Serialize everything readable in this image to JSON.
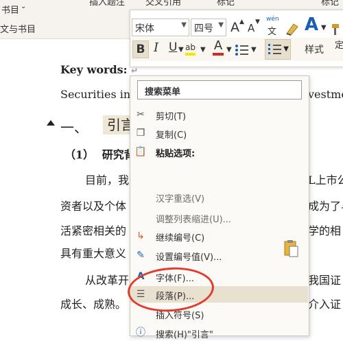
{
  "ribbon": {
    "item1": "书目",
    "item2": "插入题注",
    "item3": "交叉引用",
    "item4": "标记",
    "item5": "标记",
    "left_label": "文与书目"
  },
  "document": {
    "keywords_label": "Key words",
    "keywords_colon": ":",
    "line_securities_left": "Securities inv",
    "line_securities_right": "vestme",
    "heading_num": "一、",
    "heading_text": "引言",
    "sub_num": "（1）",
    "sub_text": "研究背",
    "p1a_left": "目前，我",
    "p1a_right": "L上市公",
    "p1b_left": "资者以及个体",
    "p1b_right": "成为了与",
    "p1c_left": "活紧密相关的",
    "p1c_right": "学的相",
    "p1d": "具有重大意义",
    "p2a_left": "从改革开",
    "p2a_right": "我国证",
    "p2b_left": "成长、成熟。",
    "p2b_right": "介入证",
    "para_mark": "↵"
  },
  "mini_toolbar": {
    "font_name": "宋体",
    "font_size": "四号",
    "grow_font": "A",
    "shrink_font": "A",
    "phonetic_top": "wén",
    "phonetic_bottom": "文",
    "bold": "B",
    "italic": "I",
    "underline": "U",
    "highlight": "ab",
    "font_color": "A",
    "styles": "样式",
    "define": "定"
  },
  "context_menu": {
    "search": "搜索菜单",
    "items": [
      {
        "label": "剪切(T)",
        "icon": "scissors-icon"
      },
      {
        "label": "复制(C)",
        "icon": "copy-icon"
      },
      {
        "label": "粘贴选项:",
        "icon": "paste-icon"
      },
      {
        "label": "汉字重选(V)",
        "icon": ""
      },
      {
        "label": "调整列表缩进(U)...",
        "icon": ""
      },
      {
        "label": "继续编号(C)",
        "icon": "continue-numbering-icon"
      },
      {
        "label": "设置编号值(V)...",
        "icon": "set-numbering-icon"
      },
      {
        "label": "字体(F)...",
        "icon": "font-icon"
      },
      {
        "label": "段落(P)...",
        "icon": "paragraph-icon"
      },
      {
        "label": "插入符号(S)",
        "icon": ""
      },
      {
        "label": "搜索(H)\"引言\"",
        "icon": "search-icon"
      }
    ]
  },
  "colors": {
    "ribbon_bg": "#f6f3ee",
    "menu_bg": "#fbf9f5",
    "hover_bg": "#e9e1d0",
    "annotation_circle": "#e23b2e",
    "highlight_yellow": "#f5e800",
    "font_color_red": "#d62828"
  }
}
